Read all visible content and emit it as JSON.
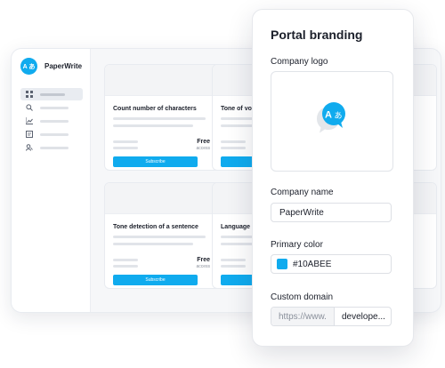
{
  "sidebar": {
    "app_name": "PaperWrite",
    "logo_text": "A あ",
    "nav_icons": [
      "grid-icon",
      "search-icon",
      "chart-icon",
      "document-icon",
      "users-icon"
    ]
  },
  "cards": [
    {
      "title": "Count number of characters",
      "price": "Free",
      "price_sub": "access",
      "button": "Subscribe"
    },
    {
      "title": "Tone of voi",
      "price": "",
      "price_sub": "",
      "button": ""
    },
    {
      "title": "Tone detection of a sentence",
      "price": "Free",
      "price_sub": "access",
      "button": "Subscribe"
    },
    {
      "title": "Language i",
      "price": "",
      "price_sub": "",
      "button": ""
    }
  ],
  "panel": {
    "title": "Portal branding",
    "logo_label": "Company logo",
    "logo_glyph_a": "A",
    "logo_glyph_b": "あ",
    "name_label": "Company name",
    "name_value": "PaperWrite",
    "color_label": "Primary color",
    "color_value": "#10ABEE",
    "domain_label": "Custom domain",
    "domain_prefix": "https://www.",
    "domain_value": "develope..."
  },
  "colors": {
    "accent": "#10ABEE"
  }
}
